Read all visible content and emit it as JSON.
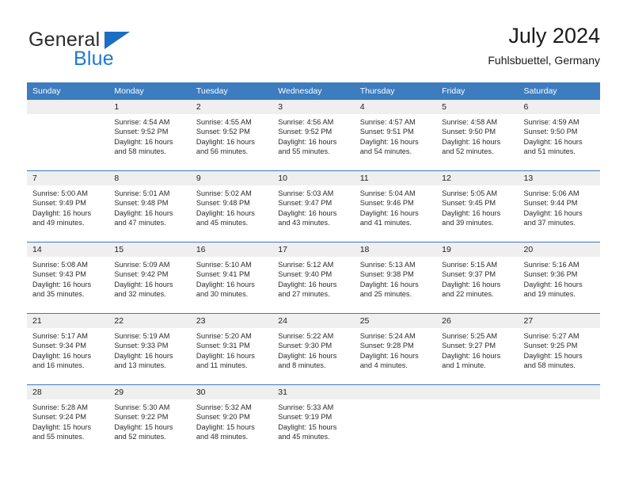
{
  "brand": {
    "name_part1": "General",
    "name_part2": "Blue",
    "triangle_color": "#1b6ec2",
    "blue_color": "#1b7ad4"
  },
  "header": {
    "title": "July 2024",
    "subtitle": "Fuhlsbuettel, Germany"
  },
  "theme": {
    "header_bar_color": "#3c7cbf",
    "day_number_band_color": "#efefef",
    "row_divider_color": "#3c7cbf"
  },
  "weekdays": [
    "Sunday",
    "Monday",
    "Tuesday",
    "Wednesday",
    "Thursday",
    "Friday",
    "Saturday"
  ],
  "weeks": [
    [
      {
        "day": "",
        "sunrise": "",
        "sunset": "",
        "daylight1": "",
        "daylight2": ""
      },
      {
        "day": "1",
        "sunrise": "Sunrise: 4:54 AM",
        "sunset": "Sunset: 9:52 PM",
        "daylight1": "Daylight: 16 hours",
        "daylight2": "and 58 minutes."
      },
      {
        "day": "2",
        "sunrise": "Sunrise: 4:55 AM",
        "sunset": "Sunset: 9:52 PM",
        "daylight1": "Daylight: 16 hours",
        "daylight2": "and 56 minutes."
      },
      {
        "day": "3",
        "sunrise": "Sunrise: 4:56 AM",
        "sunset": "Sunset: 9:52 PM",
        "daylight1": "Daylight: 16 hours",
        "daylight2": "and 55 minutes."
      },
      {
        "day": "4",
        "sunrise": "Sunrise: 4:57 AM",
        "sunset": "Sunset: 9:51 PM",
        "daylight1": "Daylight: 16 hours",
        "daylight2": "and 54 minutes."
      },
      {
        "day": "5",
        "sunrise": "Sunrise: 4:58 AM",
        "sunset": "Sunset: 9:50 PM",
        "daylight1": "Daylight: 16 hours",
        "daylight2": "and 52 minutes."
      },
      {
        "day": "6",
        "sunrise": "Sunrise: 4:59 AM",
        "sunset": "Sunset: 9:50 PM",
        "daylight1": "Daylight: 16 hours",
        "daylight2": "and 51 minutes."
      }
    ],
    [
      {
        "day": "7",
        "sunrise": "Sunrise: 5:00 AM",
        "sunset": "Sunset: 9:49 PM",
        "daylight1": "Daylight: 16 hours",
        "daylight2": "and 49 minutes."
      },
      {
        "day": "8",
        "sunrise": "Sunrise: 5:01 AM",
        "sunset": "Sunset: 9:48 PM",
        "daylight1": "Daylight: 16 hours",
        "daylight2": "and 47 minutes."
      },
      {
        "day": "9",
        "sunrise": "Sunrise: 5:02 AM",
        "sunset": "Sunset: 9:48 PM",
        "daylight1": "Daylight: 16 hours",
        "daylight2": "and 45 minutes."
      },
      {
        "day": "10",
        "sunrise": "Sunrise: 5:03 AM",
        "sunset": "Sunset: 9:47 PM",
        "daylight1": "Daylight: 16 hours",
        "daylight2": "and 43 minutes."
      },
      {
        "day": "11",
        "sunrise": "Sunrise: 5:04 AM",
        "sunset": "Sunset: 9:46 PM",
        "daylight1": "Daylight: 16 hours",
        "daylight2": "and 41 minutes."
      },
      {
        "day": "12",
        "sunrise": "Sunrise: 5:05 AM",
        "sunset": "Sunset: 9:45 PM",
        "daylight1": "Daylight: 16 hours",
        "daylight2": "and 39 minutes."
      },
      {
        "day": "13",
        "sunrise": "Sunrise: 5:06 AM",
        "sunset": "Sunset: 9:44 PM",
        "daylight1": "Daylight: 16 hours",
        "daylight2": "and 37 minutes."
      }
    ],
    [
      {
        "day": "14",
        "sunrise": "Sunrise: 5:08 AM",
        "sunset": "Sunset: 9:43 PM",
        "daylight1": "Daylight: 16 hours",
        "daylight2": "and 35 minutes."
      },
      {
        "day": "15",
        "sunrise": "Sunrise: 5:09 AM",
        "sunset": "Sunset: 9:42 PM",
        "daylight1": "Daylight: 16 hours",
        "daylight2": "and 32 minutes."
      },
      {
        "day": "16",
        "sunrise": "Sunrise: 5:10 AM",
        "sunset": "Sunset: 9:41 PM",
        "daylight1": "Daylight: 16 hours",
        "daylight2": "and 30 minutes."
      },
      {
        "day": "17",
        "sunrise": "Sunrise: 5:12 AM",
        "sunset": "Sunset: 9:40 PM",
        "daylight1": "Daylight: 16 hours",
        "daylight2": "and 27 minutes."
      },
      {
        "day": "18",
        "sunrise": "Sunrise: 5:13 AM",
        "sunset": "Sunset: 9:38 PM",
        "daylight1": "Daylight: 16 hours",
        "daylight2": "and 25 minutes."
      },
      {
        "day": "19",
        "sunrise": "Sunrise: 5:15 AM",
        "sunset": "Sunset: 9:37 PM",
        "daylight1": "Daylight: 16 hours",
        "daylight2": "and 22 minutes."
      },
      {
        "day": "20",
        "sunrise": "Sunrise: 5:16 AM",
        "sunset": "Sunset: 9:36 PM",
        "daylight1": "Daylight: 16 hours",
        "daylight2": "and 19 minutes."
      }
    ],
    [
      {
        "day": "21",
        "sunrise": "Sunrise: 5:17 AM",
        "sunset": "Sunset: 9:34 PM",
        "daylight1": "Daylight: 16 hours",
        "daylight2": "and 16 minutes."
      },
      {
        "day": "22",
        "sunrise": "Sunrise: 5:19 AM",
        "sunset": "Sunset: 9:33 PM",
        "daylight1": "Daylight: 16 hours",
        "daylight2": "and 13 minutes."
      },
      {
        "day": "23",
        "sunrise": "Sunrise: 5:20 AM",
        "sunset": "Sunset: 9:31 PM",
        "daylight1": "Daylight: 16 hours",
        "daylight2": "and 11 minutes."
      },
      {
        "day": "24",
        "sunrise": "Sunrise: 5:22 AM",
        "sunset": "Sunset: 9:30 PM",
        "daylight1": "Daylight: 16 hours",
        "daylight2": "and 8 minutes."
      },
      {
        "day": "25",
        "sunrise": "Sunrise: 5:24 AM",
        "sunset": "Sunset: 9:28 PM",
        "daylight1": "Daylight: 16 hours",
        "daylight2": "and 4 minutes."
      },
      {
        "day": "26",
        "sunrise": "Sunrise: 5:25 AM",
        "sunset": "Sunset: 9:27 PM",
        "daylight1": "Daylight: 16 hours",
        "daylight2": "and 1 minute."
      },
      {
        "day": "27",
        "sunrise": "Sunrise: 5:27 AM",
        "sunset": "Sunset: 9:25 PM",
        "daylight1": "Daylight: 15 hours",
        "daylight2": "and 58 minutes."
      }
    ],
    [
      {
        "day": "28",
        "sunrise": "Sunrise: 5:28 AM",
        "sunset": "Sunset: 9:24 PM",
        "daylight1": "Daylight: 15 hours",
        "daylight2": "and 55 minutes."
      },
      {
        "day": "29",
        "sunrise": "Sunrise: 5:30 AM",
        "sunset": "Sunset: 9:22 PM",
        "daylight1": "Daylight: 15 hours",
        "daylight2": "and 52 minutes."
      },
      {
        "day": "30",
        "sunrise": "Sunrise: 5:32 AM",
        "sunset": "Sunset: 9:20 PM",
        "daylight1": "Daylight: 15 hours",
        "daylight2": "and 48 minutes."
      },
      {
        "day": "31",
        "sunrise": "Sunrise: 5:33 AM",
        "sunset": "Sunset: 9:19 PM",
        "daylight1": "Daylight: 15 hours",
        "daylight2": "and 45 minutes."
      },
      {
        "day": "",
        "sunrise": "",
        "sunset": "",
        "daylight1": "",
        "daylight2": ""
      },
      {
        "day": "",
        "sunrise": "",
        "sunset": "",
        "daylight1": "",
        "daylight2": ""
      },
      {
        "day": "",
        "sunrise": "",
        "sunset": "",
        "daylight1": "",
        "daylight2": ""
      }
    ]
  ]
}
